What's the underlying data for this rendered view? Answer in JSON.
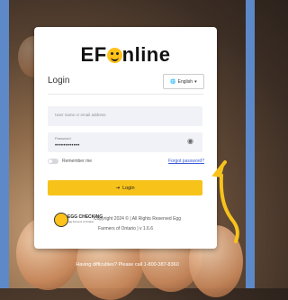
{
  "app": {
    "logo_text_1": "EF",
    "logo_text_2": "nline",
    "title": "Login",
    "language": "English"
  },
  "form": {
    "username_placeholder": "User name or email address",
    "password_label": "Password",
    "password_value": "••••••••••••",
    "remember_label": "Remember me",
    "forgot_label": "Forgot password?",
    "login_label": "Login"
  },
  "footer": {
    "egg_brand": "EGG CHECKING",
    "egg_sub": "Egg Farmers of Ontario",
    "copyright": "Copyright 2024 © | All Rights Reserved Egg",
    "copyright_2": "Farmers of Ontario | v 1.6.6"
  },
  "help_text": "Having difficulties? Please call 1-800-387-8360",
  "colors": {
    "accent": "#f7c31b",
    "link": "#3b5ad6",
    "frame": "#5d89c9"
  }
}
